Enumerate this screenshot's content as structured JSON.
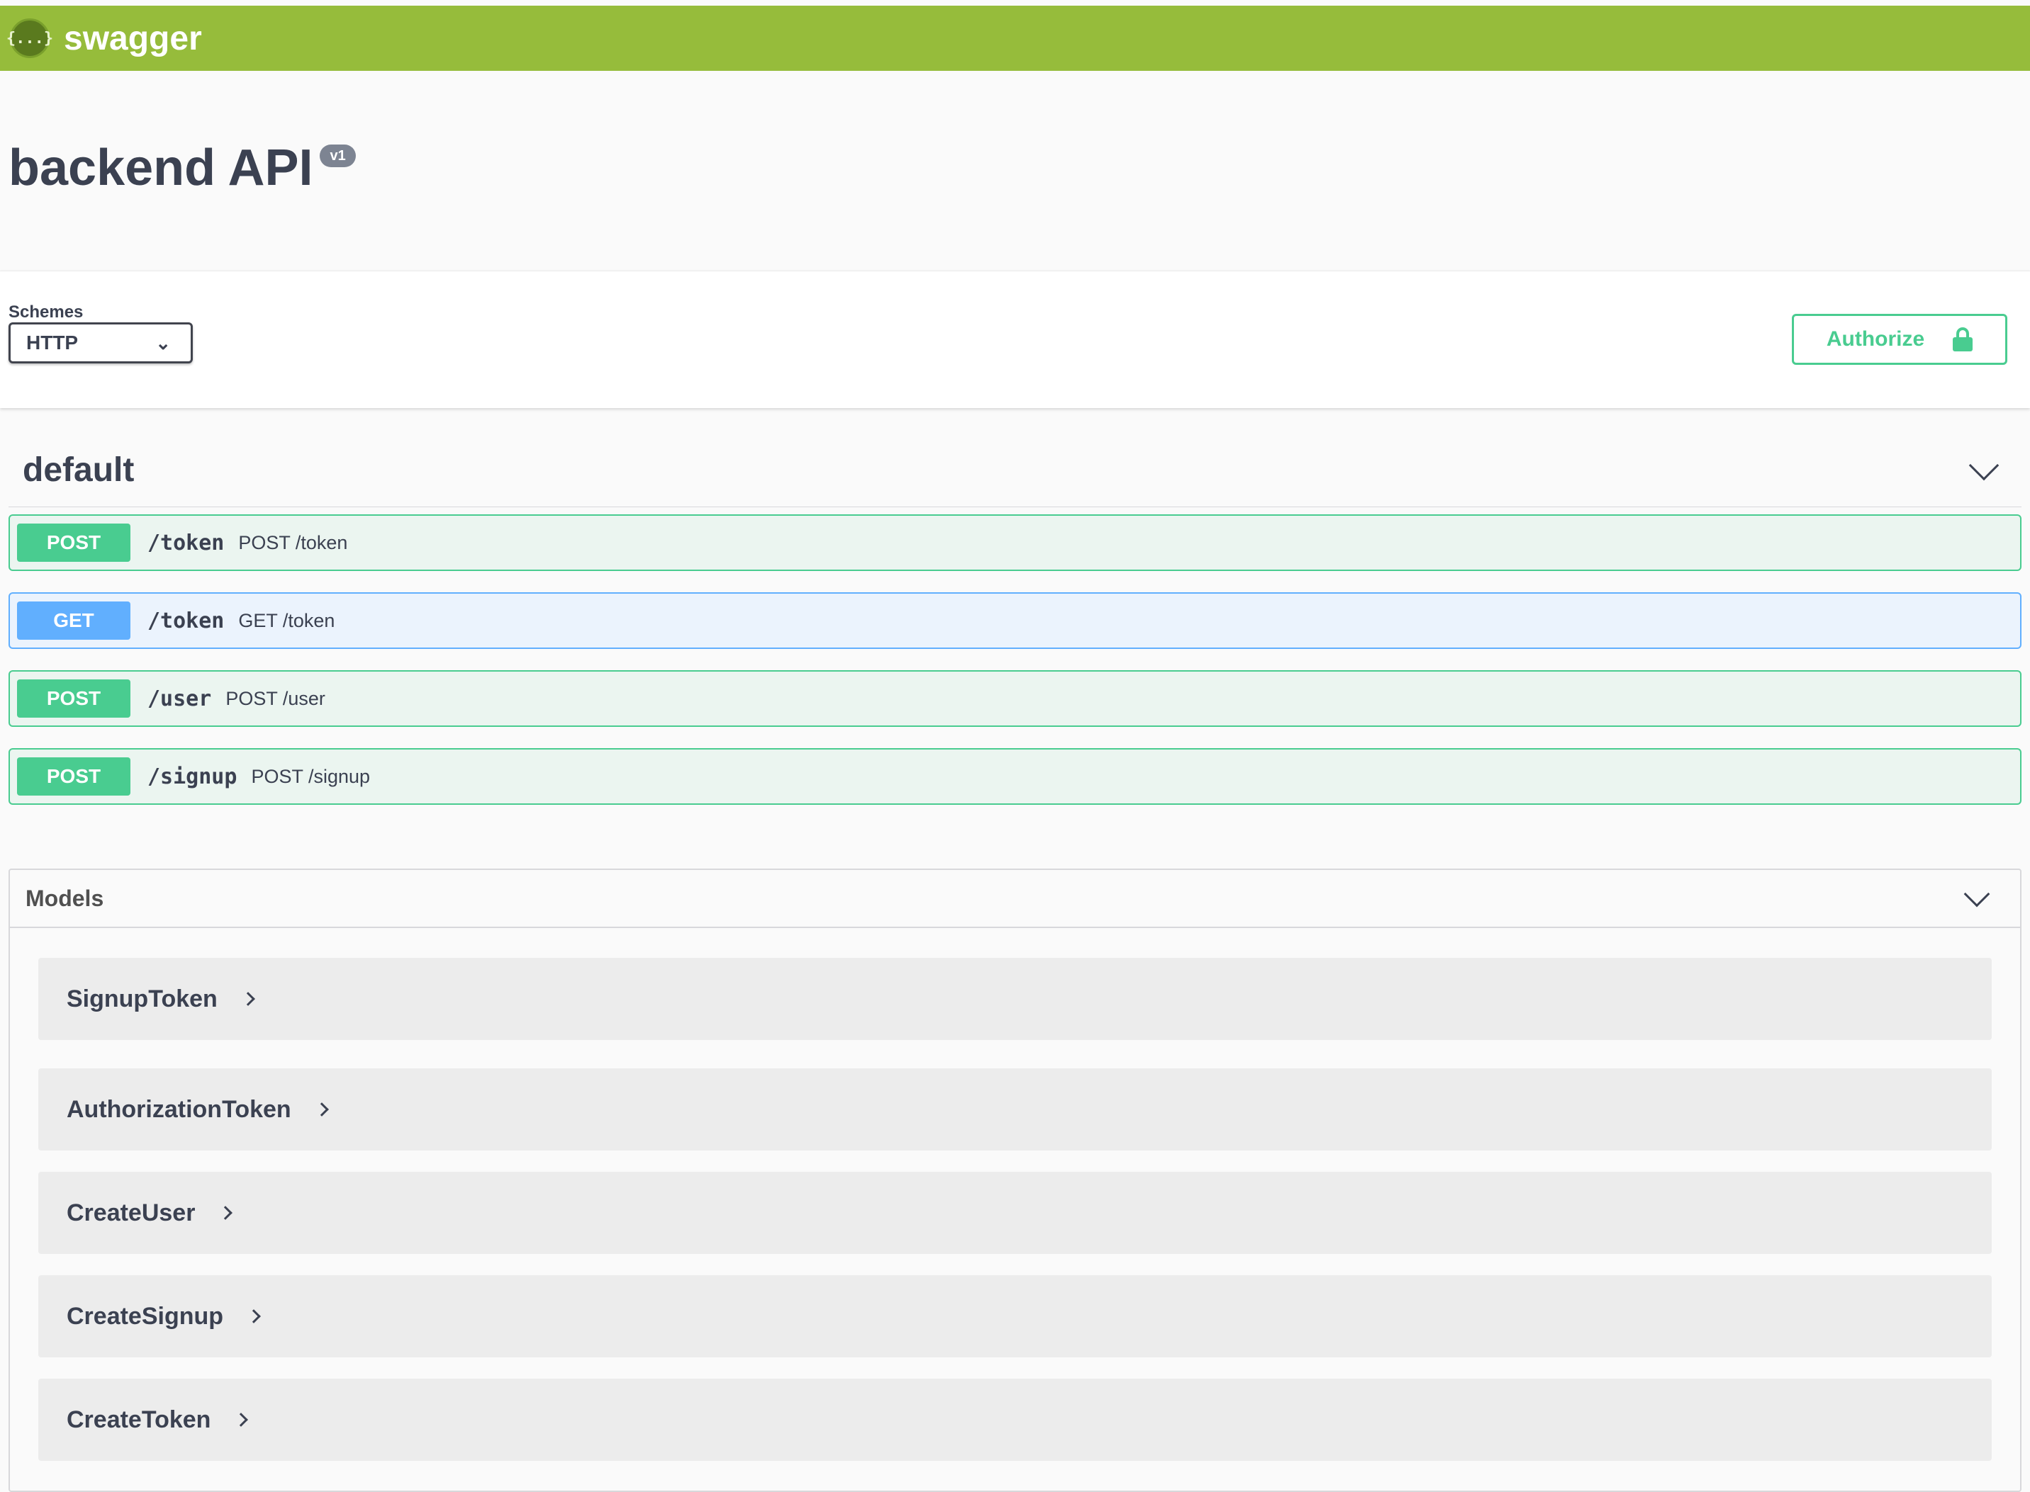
{
  "topbar": {
    "logo_text": "swagger",
    "logo_glyph": "{...}"
  },
  "info": {
    "title": "backend API",
    "version": "v1"
  },
  "schemes": {
    "label": "Schemes",
    "selected": "HTTP"
  },
  "authorize": {
    "label": "Authorize"
  },
  "tag": {
    "name": "default"
  },
  "operations": [
    {
      "method": "POST",
      "path": "/token",
      "summary": "POST /token"
    },
    {
      "method": "GET",
      "path": "/token",
      "summary": "GET /token"
    },
    {
      "method": "POST",
      "path": "/user",
      "summary": "POST /user"
    },
    {
      "method": "POST",
      "path": "/signup",
      "summary": "POST /signup"
    }
  ],
  "models": {
    "title": "Models",
    "items": [
      "SignupToken",
      "AuthorizationToken",
      "CreateUser",
      "CreateSignup",
      "CreateToken"
    ]
  },
  "colors": {
    "topbar": "#96bc3b",
    "post": "#49cc90",
    "get": "#61affe"
  }
}
